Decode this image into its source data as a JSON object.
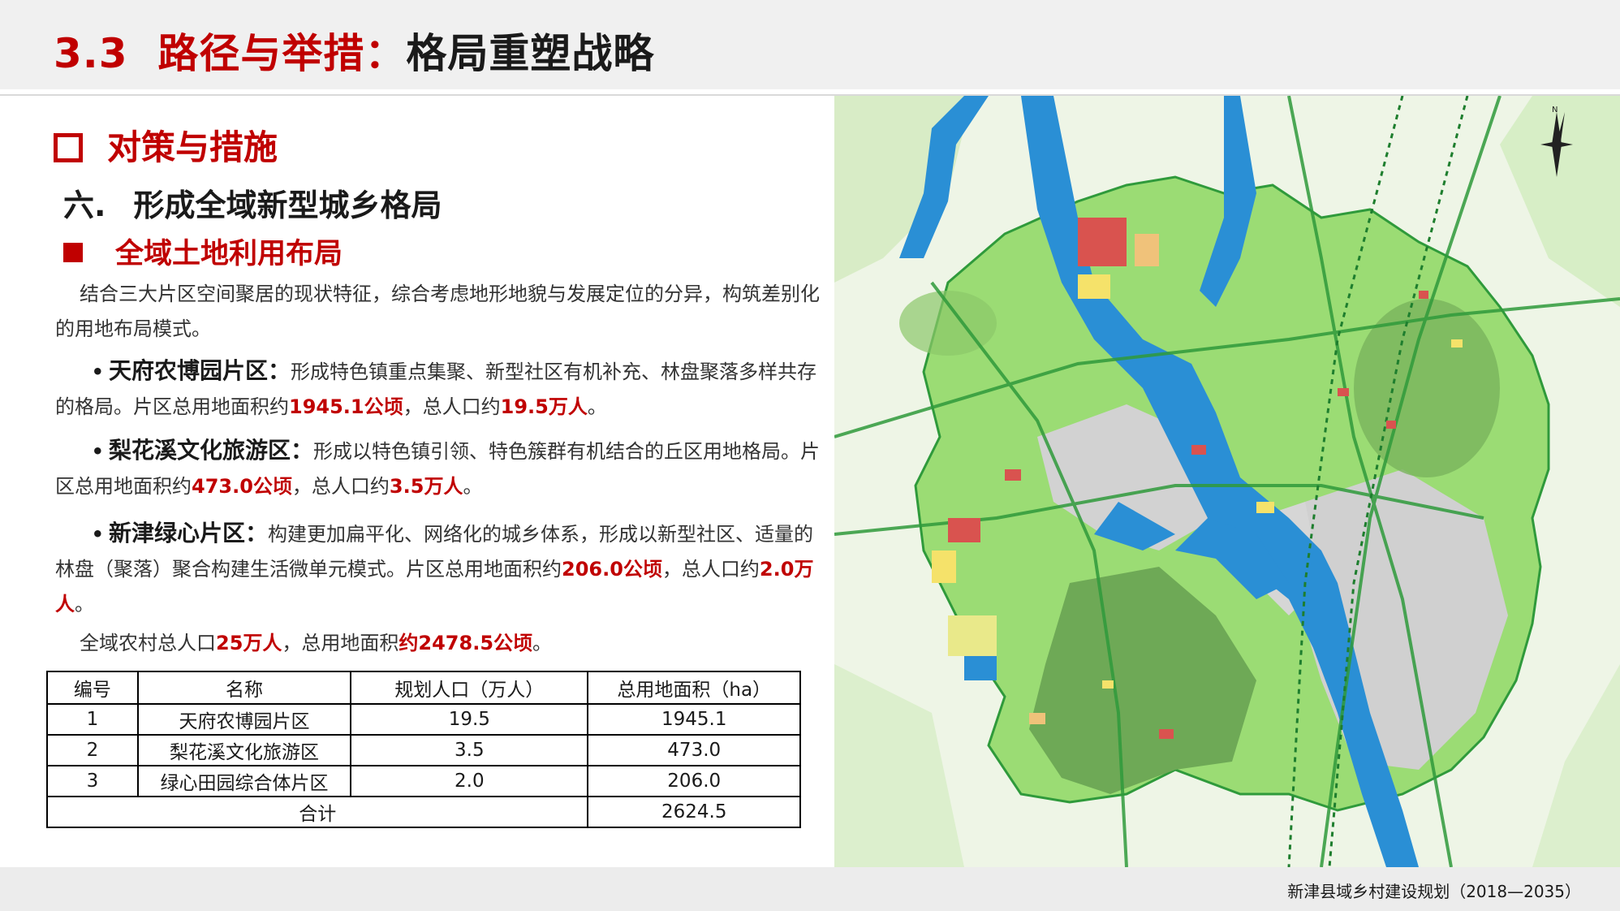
{
  "header": {
    "number": "3.3",
    "red_title": "路径与举措：",
    "black_title": "格局重塑战略"
  },
  "section": {
    "title": "对策与措施"
  },
  "subsection": {
    "number": "六.",
    "title": "形成全域新型城乡格局"
  },
  "subsubsection": {
    "title": "全域土地利用布局"
  },
  "intro": "结合三大片区空间聚居的现状特征，综合考虑地形地貌与发展定位的分异，构筑差别化的用地布局模式。",
  "zones": [
    {
      "bullet": "•",
      "name": "天府农博园片区：",
      "text": "形成特色镇重点集聚、新型社区有机补充、林盘聚落多样共存的格局。片区总用地面积约",
      "area": "1945.1公顷",
      "mid": "，总人口约",
      "pop": "19.5万人",
      "end": "。"
    },
    {
      "bullet": "•",
      "name": "梨花溪文化旅游区：",
      "text": "形成以特色镇引领、特色簇群有机结合的丘区用地格局。片区总用地面积约",
      "area": "473.0公顷",
      "mid": "，总人口约",
      "pop": "3.5万人",
      "end": "。"
    },
    {
      "bullet": "•",
      "name": "新津绿心片区：",
      "text": "构建更加扁平化、网络化的城乡体系，形成以新型社区、适量的林盘（聚落）聚合构建生活微单元模式。片区总用地面积约",
      "area": "206.0公顷",
      "mid": "，总人口约",
      "pop": "2.0万人",
      "end": "。"
    }
  ],
  "summary": {
    "pre": "全域农村总人口",
    "pop": "25万人",
    "mid": "，总用地面积",
    "area": "约2478.5公顷",
    "end": "。"
  },
  "table": {
    "headers": [
      "编号",
      "名称",
      "规划人口（万人）",
      "总用地面积（ha）"
    ],
    "rows": [
      [
        "1",
        "天府农博园片区",
        "19.5",
        "1945.1"
      ],
      [
        "2",
        "梨花溪文化旅游区",
        "3.5",
        "473.0"
      ],
      [
        "3",
        "绿心田园综合体片区",
        "2.0",
        "206.0"
      ]
    ],
    "total_label": "合计",
    "total_value": "2624.5"
  },
  "map": {
    "north_label": "N"
  },
  "footer": "新津县域乡村建设规划（2018—2035）",
  "colors": {
    "accent": "#c00000",
    "land_green": "#8fd66a",
    "river": "#1f8fd3",
    "urban": "#cfcfcf"
  }
}
